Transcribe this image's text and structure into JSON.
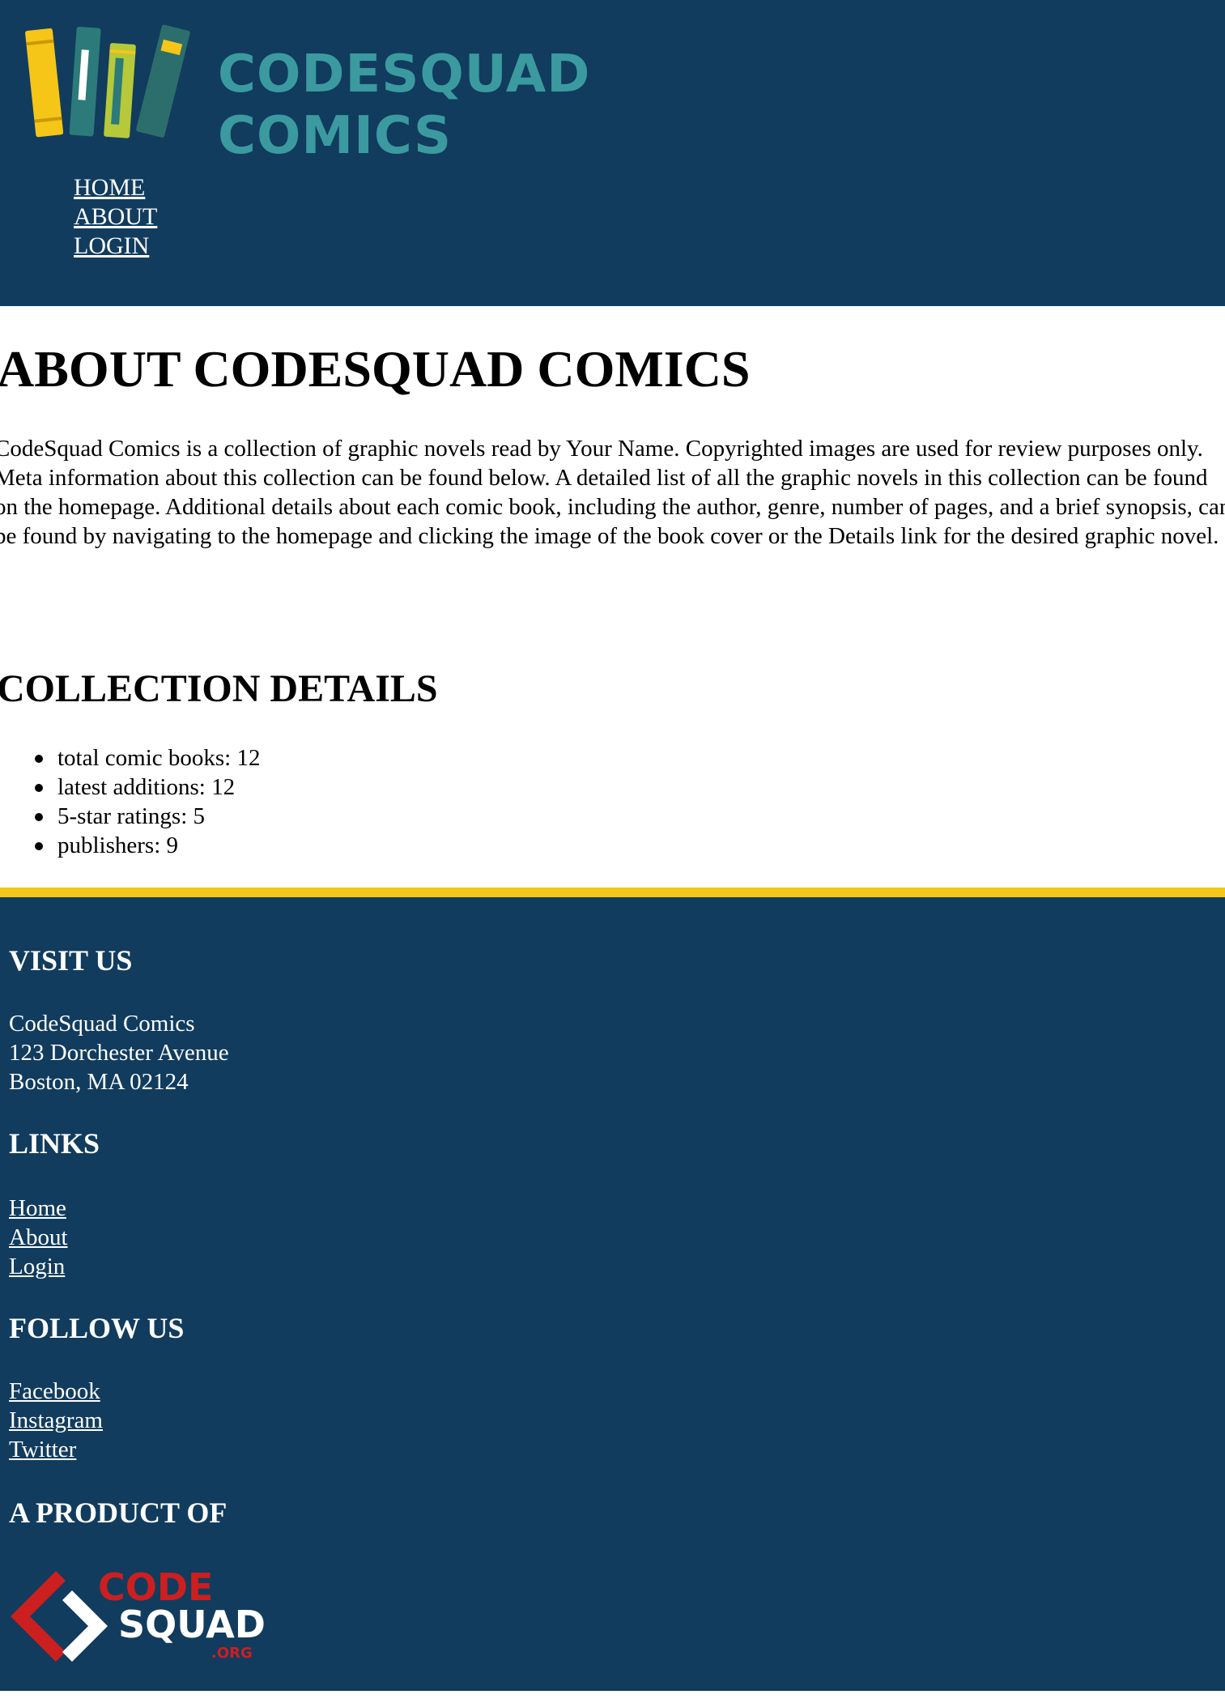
{
  "header": {
    "logo_text_line1": "CODESQUAD",
    "logo_text_line2": "COMICS",
    "nav": [
      "HOME",
      "ABOUT",
      "LOGIN"
    ]
  },
  "main": {
    "title": "ABOUT CODESQUAD COMICS",
    "intro": "CodeSquad Comics is a collection of graphic novels read by Your Name. Copyrighted images are used for review purposes only. Meta information about this collection can be found below. A detailed list of all the graphic novels in this collection can be found on the homepage. Additional details about each comic book, including the author, genre, number of pages, and a brief synopsis, can be found by navigating to the homepage and clicking the image of the book cover or the Details link for the desired graphic novel.",
    "details_title": "COLLECTION DETAILS",
    "details": [
      "total comic books: 12",
      "latest additions: 12",
      "5-star ratings: 5",
      "publishers: 9"
    ]
  },
  "footer": {
    "visit_heading": "VISIT US",
    "address": [
      "CodeSquad Comics",
      "123 Dorchester Avenue",
      "Boston, MA 02124"
    ],
    "links_heading": "LINKS",
    "links": [
      "Home",
      "About",
      "Login"
    ],
    "follow_heading": "FOLLOW US",
    "social": [
      "Facebook",
      "Instagram",
      "Twitter"
    ],
    "product_heading": "A PRODUCT OF",
    "product_logo": {
      "code": "CODE",
      "squad": "SQUAD",
      "org": ".ORG"
    }
  },
  "colors": {
    "navy": "#113c5e",
    "teal": "#3b9aa0",
    "yellow": "#f5c518",
    "red": "#cc1f1f"
  }
}
